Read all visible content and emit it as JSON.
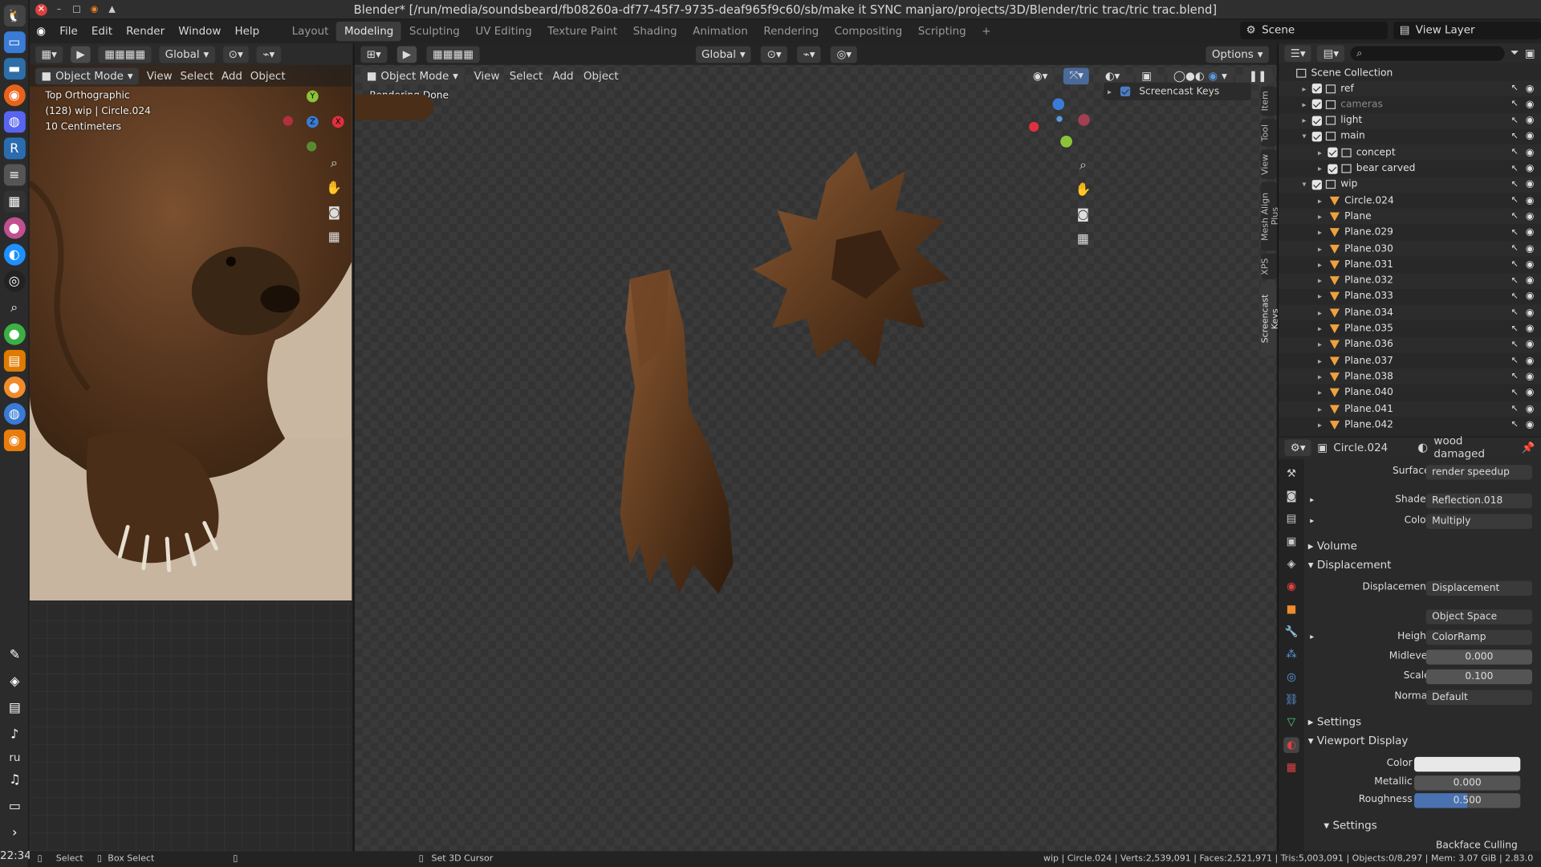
{
  "window": {
    "title": "Blender* [/run/media/soundsbeard/fb08260a-df77-45f7-9735-deaf965f9c60/sb/make it SYNC manjaro/projects/3D/Blender/tric trac/tric trac.blend]"
  },
  "dock": {
    "time": "22:34",
    "lang": "ru"
  },
  "menu": {
    "items": [
      "File",
      "Edit",
      "Render",
      "Window",
      "Help"
    ]
  },
  "workspaces": [
    {
      "label": "Layout",
      "active": false
    },
    {
      "label": "Modeling",
      "active": true
    },
    {
      "label": "Sculpting",
      "active": false
    },
    {
      "label": "UV Editing",
      "active": false
    },
    {
      "label": "Texture Paint",
      "active": false
    },
    {
      "label": "Shading",
      "active": false
    },
    {
      "label": "Animation",
      "active": false
    },
    {
      "label": "Rendering",
      "active": false
    },
    {
      "label": "Compositing",
      "active": false
    },
    {
      "label": "Scripting",
      "active": false
    }
  ],
  "scene": {
    "name": "Scene",
    "view_layer": "View Layer"
  },
  "left_editor": {
    "mode": "Object Mode",
    "menus": [
      "View",
      "Select",
      "Add",
      "Object"
    ],
    "orientation": "Global",
    "overlay_view": "Top Orthographic",
    "overlay_obj": "(128) wip | Circle.024",
    "overlay_scale": "10 Centimeters"
  },
  "viewport": {
    "mode": "Object Mode",
    "menus": [
      "View",
      "Select",
      "Add",
      "Object"
    ],
    "orientation": "Global",
    "options": "Options",
    "status_msg": "Rendering Done",
    "screencast_label": "Screencast Keys"
  },
  "side_tabs": [
    "Item",
    "Tool",
    "View",
    "Mesh Align Plus",
    "XPS",
    "Screencast Keys"
  ],
  "outliner": {
    "root": "Scene Collection",
    "rows": [
      {
        "name": "ref",
        "indent": 0,
        "type": "collection",
        "expanded": false
      },
      {
        "name": "cameras",
        "indent": 0,
        "type": "collection",
        "expanded": false,
        "dim": true
      },
      {
        "name": "light",
        "indent": 0,
        "type": "collection",
        "expanded": false
      },
      {
        "name": "main",
        "indent": 0,
        "type": "collection",
        "expanded": true
      },
      {
        "name": "concept",
        "indent": 1,
        "type": "collection",
        "expanded": false
      },
      {
        "name": "bear carved",
        "indent": 1,
        "type": "collection",
        "expanded": false
      },
      {
        "name": "wip",
        "indent": 0,
        "type": "collection",
        "expanded": true
      },
      {
        "name": "Circle.024",
        "indent": 1,
        "type": "mesh"
      },
      {
        "name": "Plane",
        "indent": 1,
        "type": "mesh"
      },
      {
        "name": "Plane.029",
        "indent": 1,
        "type": "mesh"
      },
      {
        "name": "Plane.030",
        "indent": 1,
        "type": "mesh"
      },
      {
        "name": "Plane.031",
        "indent": 1,
        "type": "mesh"
      },
      {
        "name": "Plane.032",
        "indent": 1,
        "type": "mesh"
      },
      {
        "name": "Plane.033",
        "indent": 1,
        "type": "mesh"
      },
      {
        "name": "Plane.034",
        "indent": 1,
        "type": "mesh"
      },
      {
        "name": "Plane.035",
        "indent": 1,
        "type": "mesh"
      },
      {
        "name": "Plane.036",
        "indent": 1,
        "type": "mesh"
      },
      {
        "name": "Plane.037",
        "indent": 1,
        "type": "mesh"
      },
      {
        "name": "Plane.038",
        "indent": 1,
        "type": "mesh"
      },
      {
        "name": "Plane.040",
        "indent": 1,
        "type": "mesh"
      },
      {
        "name": "Plane.041",
        "indent": 1,
        "type": "mesh"
      },
      {
        "name": "Plane.042",
        "indent": 1,
        "type": "mesh"
      }
    ]
  },
  "properties": {
    "object": "Circle.024",
    "material": "wood damaged",
    "rows": [
      {
        "label": "Surface",
        "value": "render speedup"
      },
      {
        "label": "Shader",
        "value": "Reflection.018"
      },
      {
        "label": "Color",
        "value": "Multiply"
      }
    ],
    "sections": {
      "volume": "Volume",
      "displacement": "Displacement",
      "settings": "Settings",
      "viewport_display": "Viewport Display",
      "settings2": "Settings"
    },
    "disp_rows": [
      {
        "label": "Displacement",
        "value": "Displacement"
      },
      {
        "label": "",
        "value": "Object Space"
      },
      {
        "label": "Height",
        "value": "ColorRamp"
      },
      {
        "label": "Midlevel",
        "value": "0.000"
      },
      {
        "label": "Scale",
        "value": "0.100"
      },
      {
        "label": "Normal",
        "value": "Default"
      }
    ],
    "vd_rows": [
      {
        "label": "Color",
        "value": ""
      },
      {
        "label": "Metallic",
        "value": "0.000"
      },
      {
        "label": "Roughness",
        "value": "0.500"
      }
    ],
    "backface": "Backface Culling"
  },
  "statusbar": {
    "select": "Select",
    "box_select": "Box Select",
    "cursor": "Set 3D Cursor",
    "stats": "wip | Circle.024 | Verts:2,539,091 | Faces:2,521,971 | Tris:5,003,091 | Objects:0/8,297 | Mem: 3.07 GiB | 2.83.0"
  }
}
